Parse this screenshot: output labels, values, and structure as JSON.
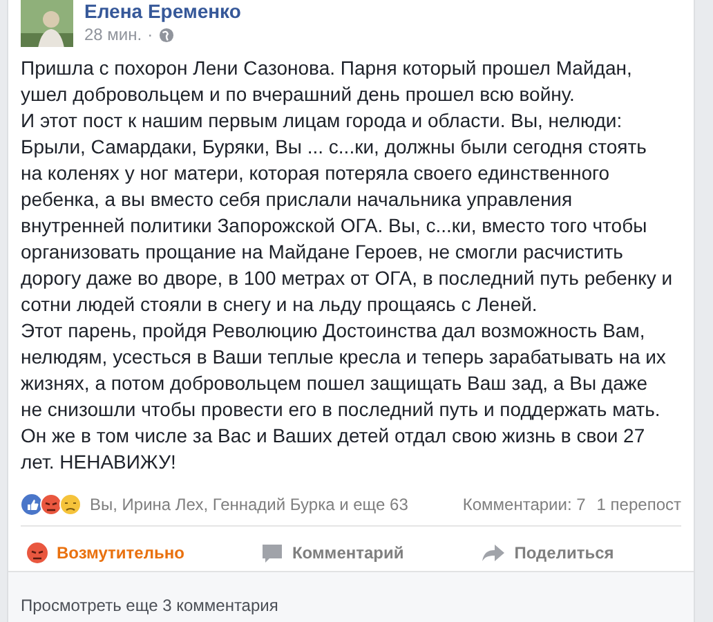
{
  "post": {
    "author": "Елена Еременко",
    "time": "28 мин.",
    "separator": "·",
    "lines": [
      "Пришла с похорон Лени Сазонова. Парня который прошел Майдан,",
      "ушел добровольцем и по вчерашний день прошел всю войну.",
      "И этот пост к нашим первым лицам города и области. Вы, нелюди:",
      "Брыли, Самардаки, Буряки, Вы ... с...ки, должны были сегодня стоять",
      "на коленях у ног матери, которая потеряла своего единственного",
      "ребенка, а вы вместо себя прислали начальника управления",
      "внутренней политики Запорожской ОГА. Вы, с...ки, вместо того чтобы",
      "организовать прощание на Майдане Героев, не смогли расчистить",
      "дорогу даже во дворе, в 100 метрах от ОГА, в последний путь ребенку и",
      "сотни людей стояли в снегу и на льду прощаясь с Леней.",
      "Этот парень, пройдя Революцию Достоинства дал возможность Вам,",
      "нелюдям, усесться в Ваши теплые кресла и теперь зарабатывать на их",
      "жизнях, а потом добровольцем пошел защищать Ваш зад, а Вы даже",
      "не снизошли чтобы провести его в последний путь и поддержать мать.",
      "Он же в том числе за Вас и Ваших детей отдал свою жизнь в свои 27",
      "лет. НЕНАВИЖУ!"
    ]
  },
  "reactions": {
    "names": "Вы, Ирина Лех, Геннадий Бурка и еще 63",
    "comments": "Комментарии: 7",
    "shares": "1 перепост"
  },
  "actions": [
    {
      "kind": "angry",
      "label": "Возмутительно",
      "selected": true
    },
    {
      "kind": "comment",
      "label": "Комментарий",
      "selected": false
    },
    {
      "kind": "share",
      "label": "Поделиться",
      "selected": false
    }
  ],
  "more_comments": "Просмотреть еще 3 комментария"
}
